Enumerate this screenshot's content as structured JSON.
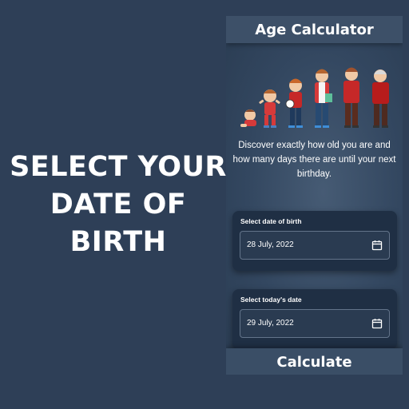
{
  "promo": {
    "lines": [
      "SELECT YOUR",
      "DATE OF",
      "BIRTH"
    ]
  },
  "app": {
    "title": "Age Calculator",
    "description": "Discover exactly how old you are and how many days there are until your next birthday.",
    "illustration": "people-growing-up-illustration",
    "dob": {
      "label": "Select date of birth",
      "value": "28 July, 2022",
      "icon": "calendar-icon"
    },
    "today": {
      "label": "Select today's date",
      "value": "29 July, 2022",
      "icon": "calendar-icon"
    },
    "calculate_label": "Calculate"
  },
  "colors": {
    "background": "#2e3f57",
    "header": "#3d5068",
    "card": "#1f2f44",
    "accent_red": "#d32f2f"
  }
}
